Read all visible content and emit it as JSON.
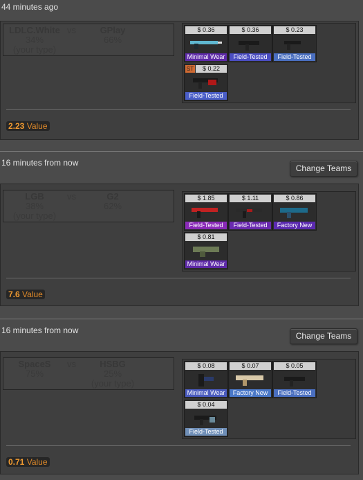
{
  "matches": [
    {
      "time": "44 minutes ago",
      "change_teams": null,
      "team1": {
        "name": "LDLC.White",
        "pct": "34%",
        "your_type": "(your type)"
      },
      "team2": {
        "name": "GPlay",
        "pct": "66%",
        "your_type": ""
      },
      "vs": "vs",
      "items": [
        {
          "price": "$ 0.36",
          "cond": "Minimal Wear",
          "st": "",
          "grade": "#5e2aa8"
        },
        {
          "price": "$ 0.36",
          "cond": "Field-Tested",
          "st": "",
          "grade": "#4b4ec2"
        },
        {
          "price": "$ 0.23",
          "cond": "Field-Tested",
          "st": "",
          "grade": "#4a6fc0"
        },
        {
          "price": "$ 0.22",
          "cond": "Field-Tested",
          "st": "ST",
          "grade": "#4a5ec8"
        }
      ],
      "value_num": "2.23",
      "value_label": "Value"
    },
    {
      "time": "16 minutes from now",
      "change_teams": "Change Teams",
      "team1": {
        "name": "LGB",
        "pct": "38%",
        "your_type": "(your type)"
      },
      "team2": {
        "name": "G2",
        "pct": "62%",
        "your_type": ""
      },
      "vs": "vs",
      "items": [
        {
          "price": "$ 1.85",
          "cond": "Field-Tested",
          "st": "",
          "grade": "#8a2ab8"
        },
        {
          "price": "$ 1.11",
          "cond": "Field-Tested",
          "st": "",
          "grade": "#6a2ab0"
        },
        {
          "price": "$ 0.86",
          "cond": "Factory New",
          "st": "",
          "grade": "#5b2ab0"
        },
        {
          "price": "$ 0.81",
          "cond": "Minimal Wear",
          "st": "",
          "grade": "#5e2aa8"
        }
      ],
      "value_num": "7.6",
      "value_label": "Value"
    },
    {
      "time": "16 minutes from now",
      "change_teams": "Change Teams",
      "team1": {
        "name": "SpaceS",
        "pct": "75%",
        "your_type": ""
      },
      "team2": {
        "name": "HSBG",
        "pct": "25%",
        "your_type": "(your type)"
      },
      "vs": "vs",
      "items": [
        {
          "price": "$ 0.08",
          "cond": "Minimal Wear",
          "st": "",
          "grade": "#4a5bbf"
        },
        {
          "price": "$ 0.07",
          "cond": "Factory New",
          "st": "",
          "grade": "#4a78c8"
        },
        {
          "price": "$ 0.05",
          "cond": "Field-Tested",
          "st": "",
          "grade": "#4a6fc0"
        },
        {
          "price": "$ 0.04",
          "cond": "Field-Tested",
          "st": "",
          "grade": "#6f8fb8"
        }
      ],
      "value_num": "0.71",
      "value_label": "Value"
    }
  ]
}
